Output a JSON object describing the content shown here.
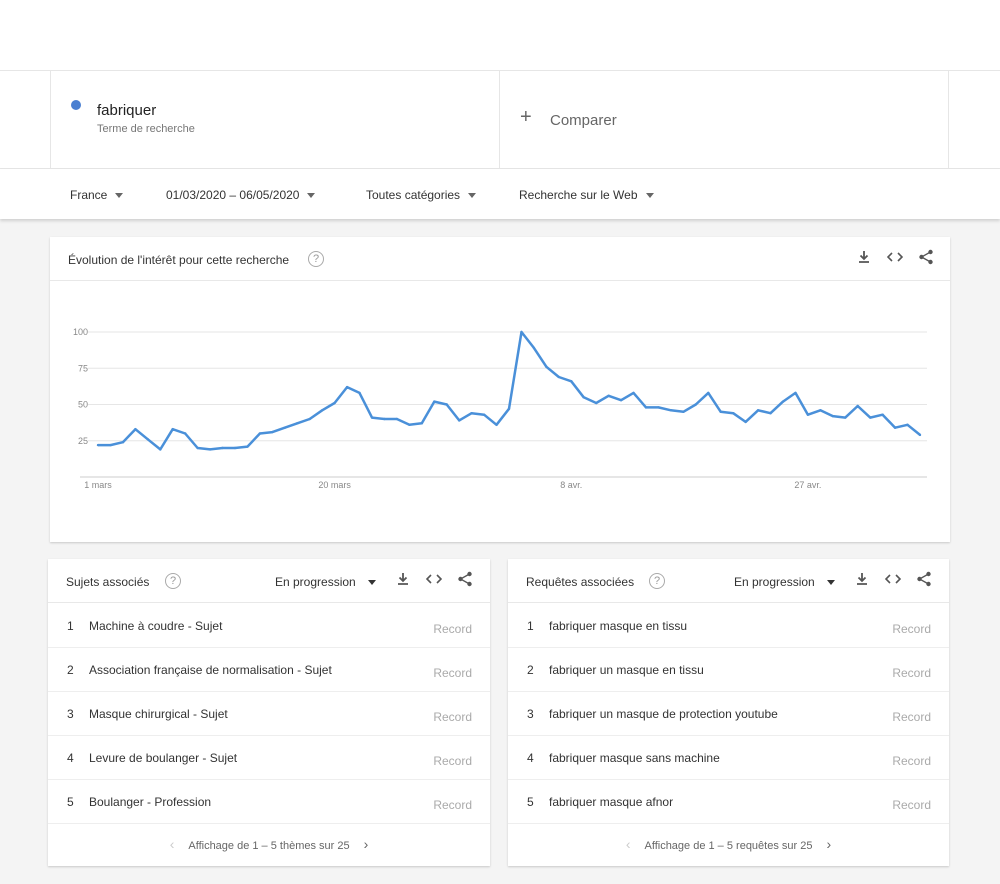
{
  "search": {
    "term": "fabriquer",
    "term_type": "Terme de recherche",
    "term_color": "#4a7fd1",
    "compare_label": "Comparer"
  },
  "filters": {
    "country": "France",
    "date_range": "01/03/2020 – 06/05/2020",
    "category": "Toutes catégories",
    "source": "Recherche sur le Web"
  },
  "interest_card": {
    "title": "Évolution de l'intérêt pour cette recherche",
    "icons": [
      "download-icon",
      "embed-icon",
      "share-icon"
    ]
  },
  "chart_data": {
    "type": "line",
    "color": "#4a90d9",
    "y_ticks": [
      "100",
      "75",
      "50",
      "25"
    ],
    "ylim": [
      0,
      100
    ],
    "x_tick_labels": [
      {
        "label": "1 mars",
        "index": 0
      },
      {
        "label": "20 mars",
        "index": 19
      },
      {
        "label": "8 avr.",
        "index": 38
      },
      {
        "label": "27 avr.",
        "index": 57
      }
    ],
    "values": [
      22,
      22,
      24,
      33,
      26,
      19,
      33,
      30,
      20,
      19,
      20,
      20,
      21,
      30,
      31,
      34,
      37,
      40,
      46,
      51,
      62,
      58,
      41,
      40,
      40,
      36,
      37,
      52,
      50,
      39,
      44,
      43,
      36,
      47,
      100,
      89,
      76,
      69,
      66,
      55,
      51,
      56,
      53,
      58,
      48,
      48,
      46,
      45,
      50,
      58,
      45,
      44,
      38,
      46,
      44,
      52,
      58,
      43,
      46,
      42,
      41,
      49,
      41,
      43,
      34,
      36,
      29
    ]
  },
  "topics_card": {
    "title": "Sujets associés",
    "sort": "En progression",
    "rows": [
      {
        "rank": "1",
        "label": "Machine à coudre - Sujet",
        "value": "Record"
      },
      {
        "rank": "2",
        "label": "Association française de normalisation - Sujet",
        "value": "Record"
      },
      {
        "rank": "3",
        "label": "Masque chirurgical - Sujet",
        "value": "Record"
      },
      {
        "rank": "4",
        "label": "Levure de boulanger - Sujet",
        "value": "Record"
      },
      {
        "rank": "5",
        "label": "Boulanger - Profession",
        "value": "Record"
      }
    ],
    "pager": "Affichage de 1 – 5 thèmes sur 25"
  },
  "queries_card": {
    "title": "Requêtes associées",
    "sort": "En progression",
    "rows": [
      {
        "rank": "1",
        "label": "fabriquer masque en tissu",
        "value": "Record"
      },
      {
        "rank": "2",
        "label": "fabriquer un masque en tissu",
        "value": "Record"
      },
      {
        "rank": "3",
        "label": "fabriquer un masque de protection youtube",
        "value": "Record"
      },
      {
        "rank": "4",
        "label": "fabriquer masque sans machine",
        "value": "Record"
      },
      {
        "rank": "5",
        "label": "fabriquer masque afnor",
        "value": "Record"
      }
    ],
    "pager": "Affichage de 1 – 5 requêtes sur 25"
  }
}
